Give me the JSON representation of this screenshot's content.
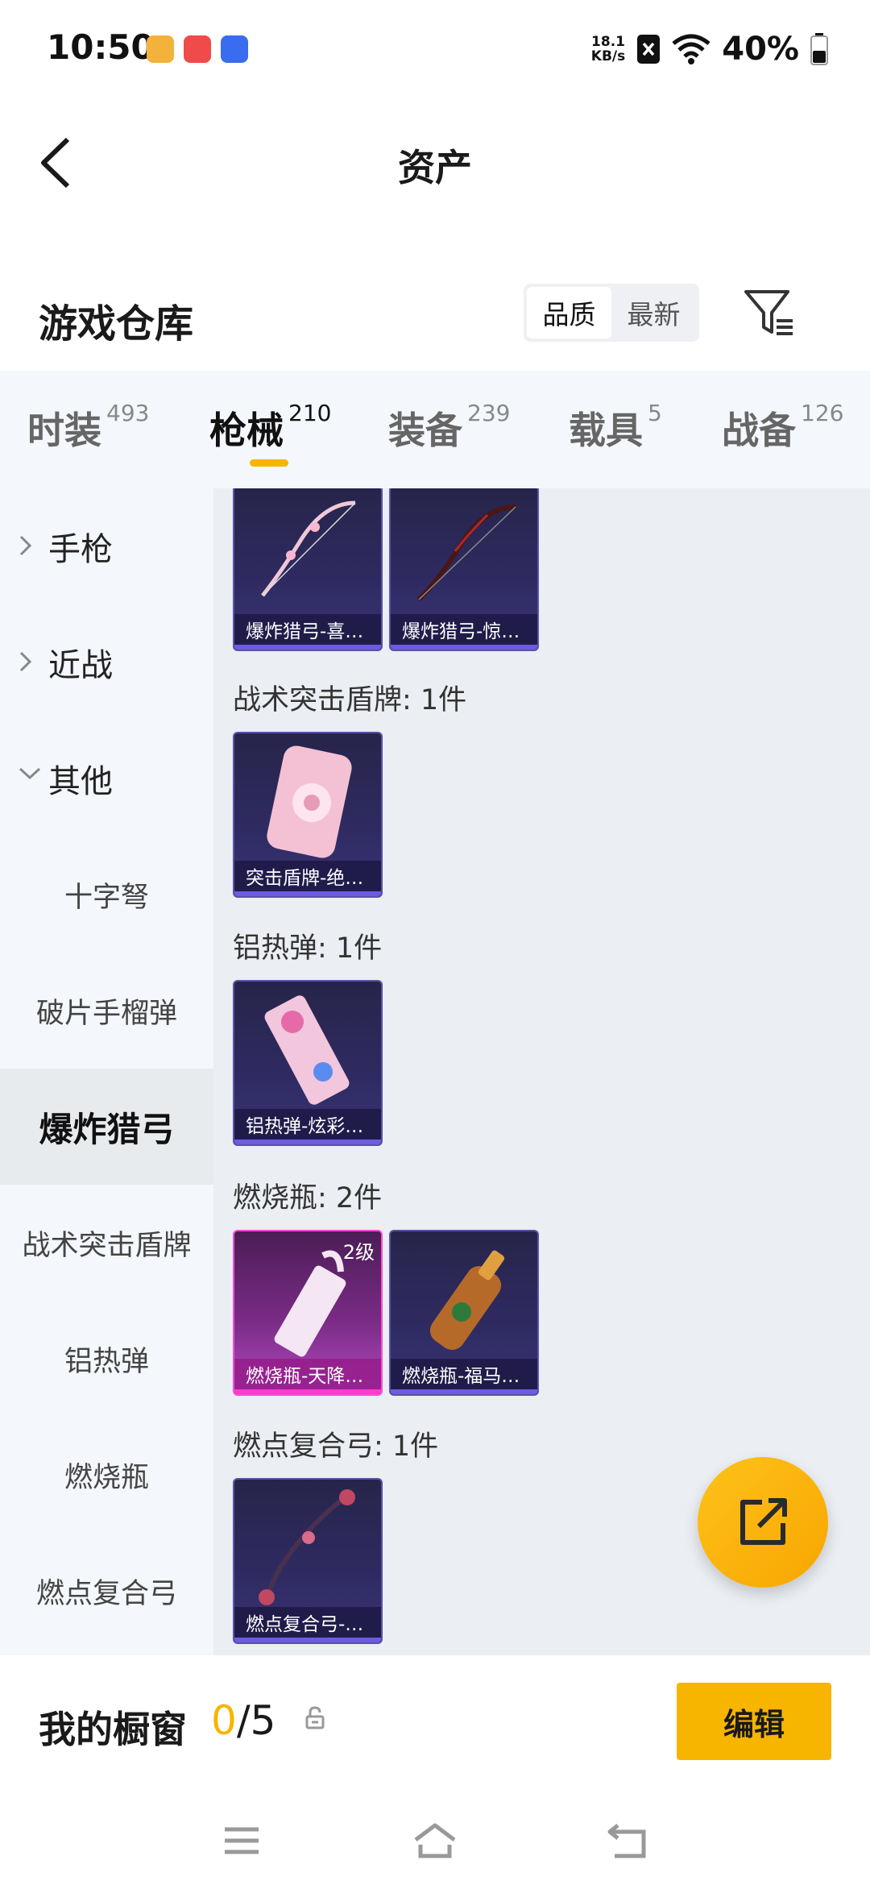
{
  "status_bar": {
    "time": "10:50",
    "net_speed_value": "18.1",
    "net_speed_unit": "KB/s",
    "battery": "40%",
    "app_badges": [
      {
        "name": "app-badge-game",
        "color": "#f3b23b"
      },
      {
        "name": "app-badge-huawei",
        "color": "#f04a4a"
      },
      {
        "name": "app-badge-vivo",
        "color": "#3a6cf0"
      }
    ]
  },
  "nav": {
    "title": "资产"
  },
  "warehouse": {
    "title": "游戏仓库",
    "sort_options": [
      "品质",
      "最新"
    ],
    "sort_selected": "品质"
  },
  "category_tabs": [
    {
      "label": "时装",
      "count": "493"
    },
    {
      "label": "枪械",
      "count": "210"
    },
    {
      "label": "装备",
      "count": "239"
    },
    {
      "label": "载具",
      "count": "5"
    },
    {
      "label": "战备",
      "count": "126"
    }
  ],
  "active_tab": "枪械",
  "sidebar": {
    "groups": [
      {
        "label": "手枪",
        "expanded": false
      },
      {
        "label": "近战",
        "expanded": false
      },
      {
        "label": "其他",
        "expanded": true
      }
    ],
    "subitems": [
      "十字弩",
      "破片手榴弹",
      "爆炸猎弓",
      "战术突击盾牌",
      "铝热弹",
      "燃烧瓶",
      "燃点复合弓"
    ],
    "active": "爆炸猎弓"
  },
  "content": {
    "top_cards": [
      {
        "name": "爆炸猎弓-喜…"
      },
      {
        "name": "爆炸猎弓-惊…"
      }
    ],
    "sections": [
      {
        "label": "战术突击盾牌: 1件",
        "cards": [
          {
            "name": "突击盾牌-绝…"
          }
        ]
      },
      {
        "label": "铝热弹: 1件",
        "cards": [
          {
            "name": "铝热弹-炫彩…"
          }
        ]
      },
      {
        "label": "燃烧瓶: 2件",
        "cards": [
          {
            "name": "燃烧瓶-天降…",
            "level": "2级",
            "rarity": "pink"
          },
          {
            "name": "燃烧瓶-福马…"
          }
        ]
      },
      {
        "label": "燃点复合弓: 1件",
        "cards": [
          {
            "name": "燃点复合弓-…"
          }
        ]
      }
    ]
  },
  "showcase": {
    "title": "我的橱窗",
    "current": "0",
    "separator": "/",
    "max": "5",
    "edit_label": "编辑"
  },
  "colors": {
    "accent": "#f7b500",
    "card_border": "#5a51a8",
    "card_pink_border": "#ff4bd6"
  }
}
